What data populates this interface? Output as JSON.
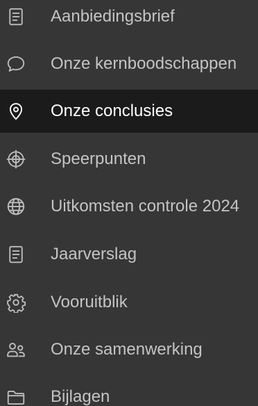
{
  "nav": {
    "items": [
      {
        "label": "Aanbiedingsbrief",
        "icon": "document-icon",
        "active": false
      },
      {
        "label": "Onze kernboodschappen",
        "icon": "speech-bubble-icon",
        "active": false
      },
      {
        "label": "Onze conclusies",
        "icon": "location-pin-icon",
        "active": true
      },
      {
        "label": "Speerpunten",
        "icon": "target-icon",
        "active": false
      },
      {
        "label": "Uitkomsten controle 2024",
        "icon": "globe-icon",
        "active": false
      },
      {
        "label": "Jaarverslag",
        "icon": "document-icon",
        "active": false
      },
      {
        "label": "Vooruitblik",
        "icon": "gear-icon",
        "active": false
      },
      {
        "label": "Onze samenwerking",
        "icon": "people-icon",
        "active": false
      },
      {
        "label": "Bijlagen",
        "icon": "folder-icon",
        "active": false
      }
    ]
  },
  "colors": {
    "background": "#363636",
    "active_background": "#1b1b1b",
    "text": "#c4c4c4",
    "active_text": "#ffffff"
  }
}
